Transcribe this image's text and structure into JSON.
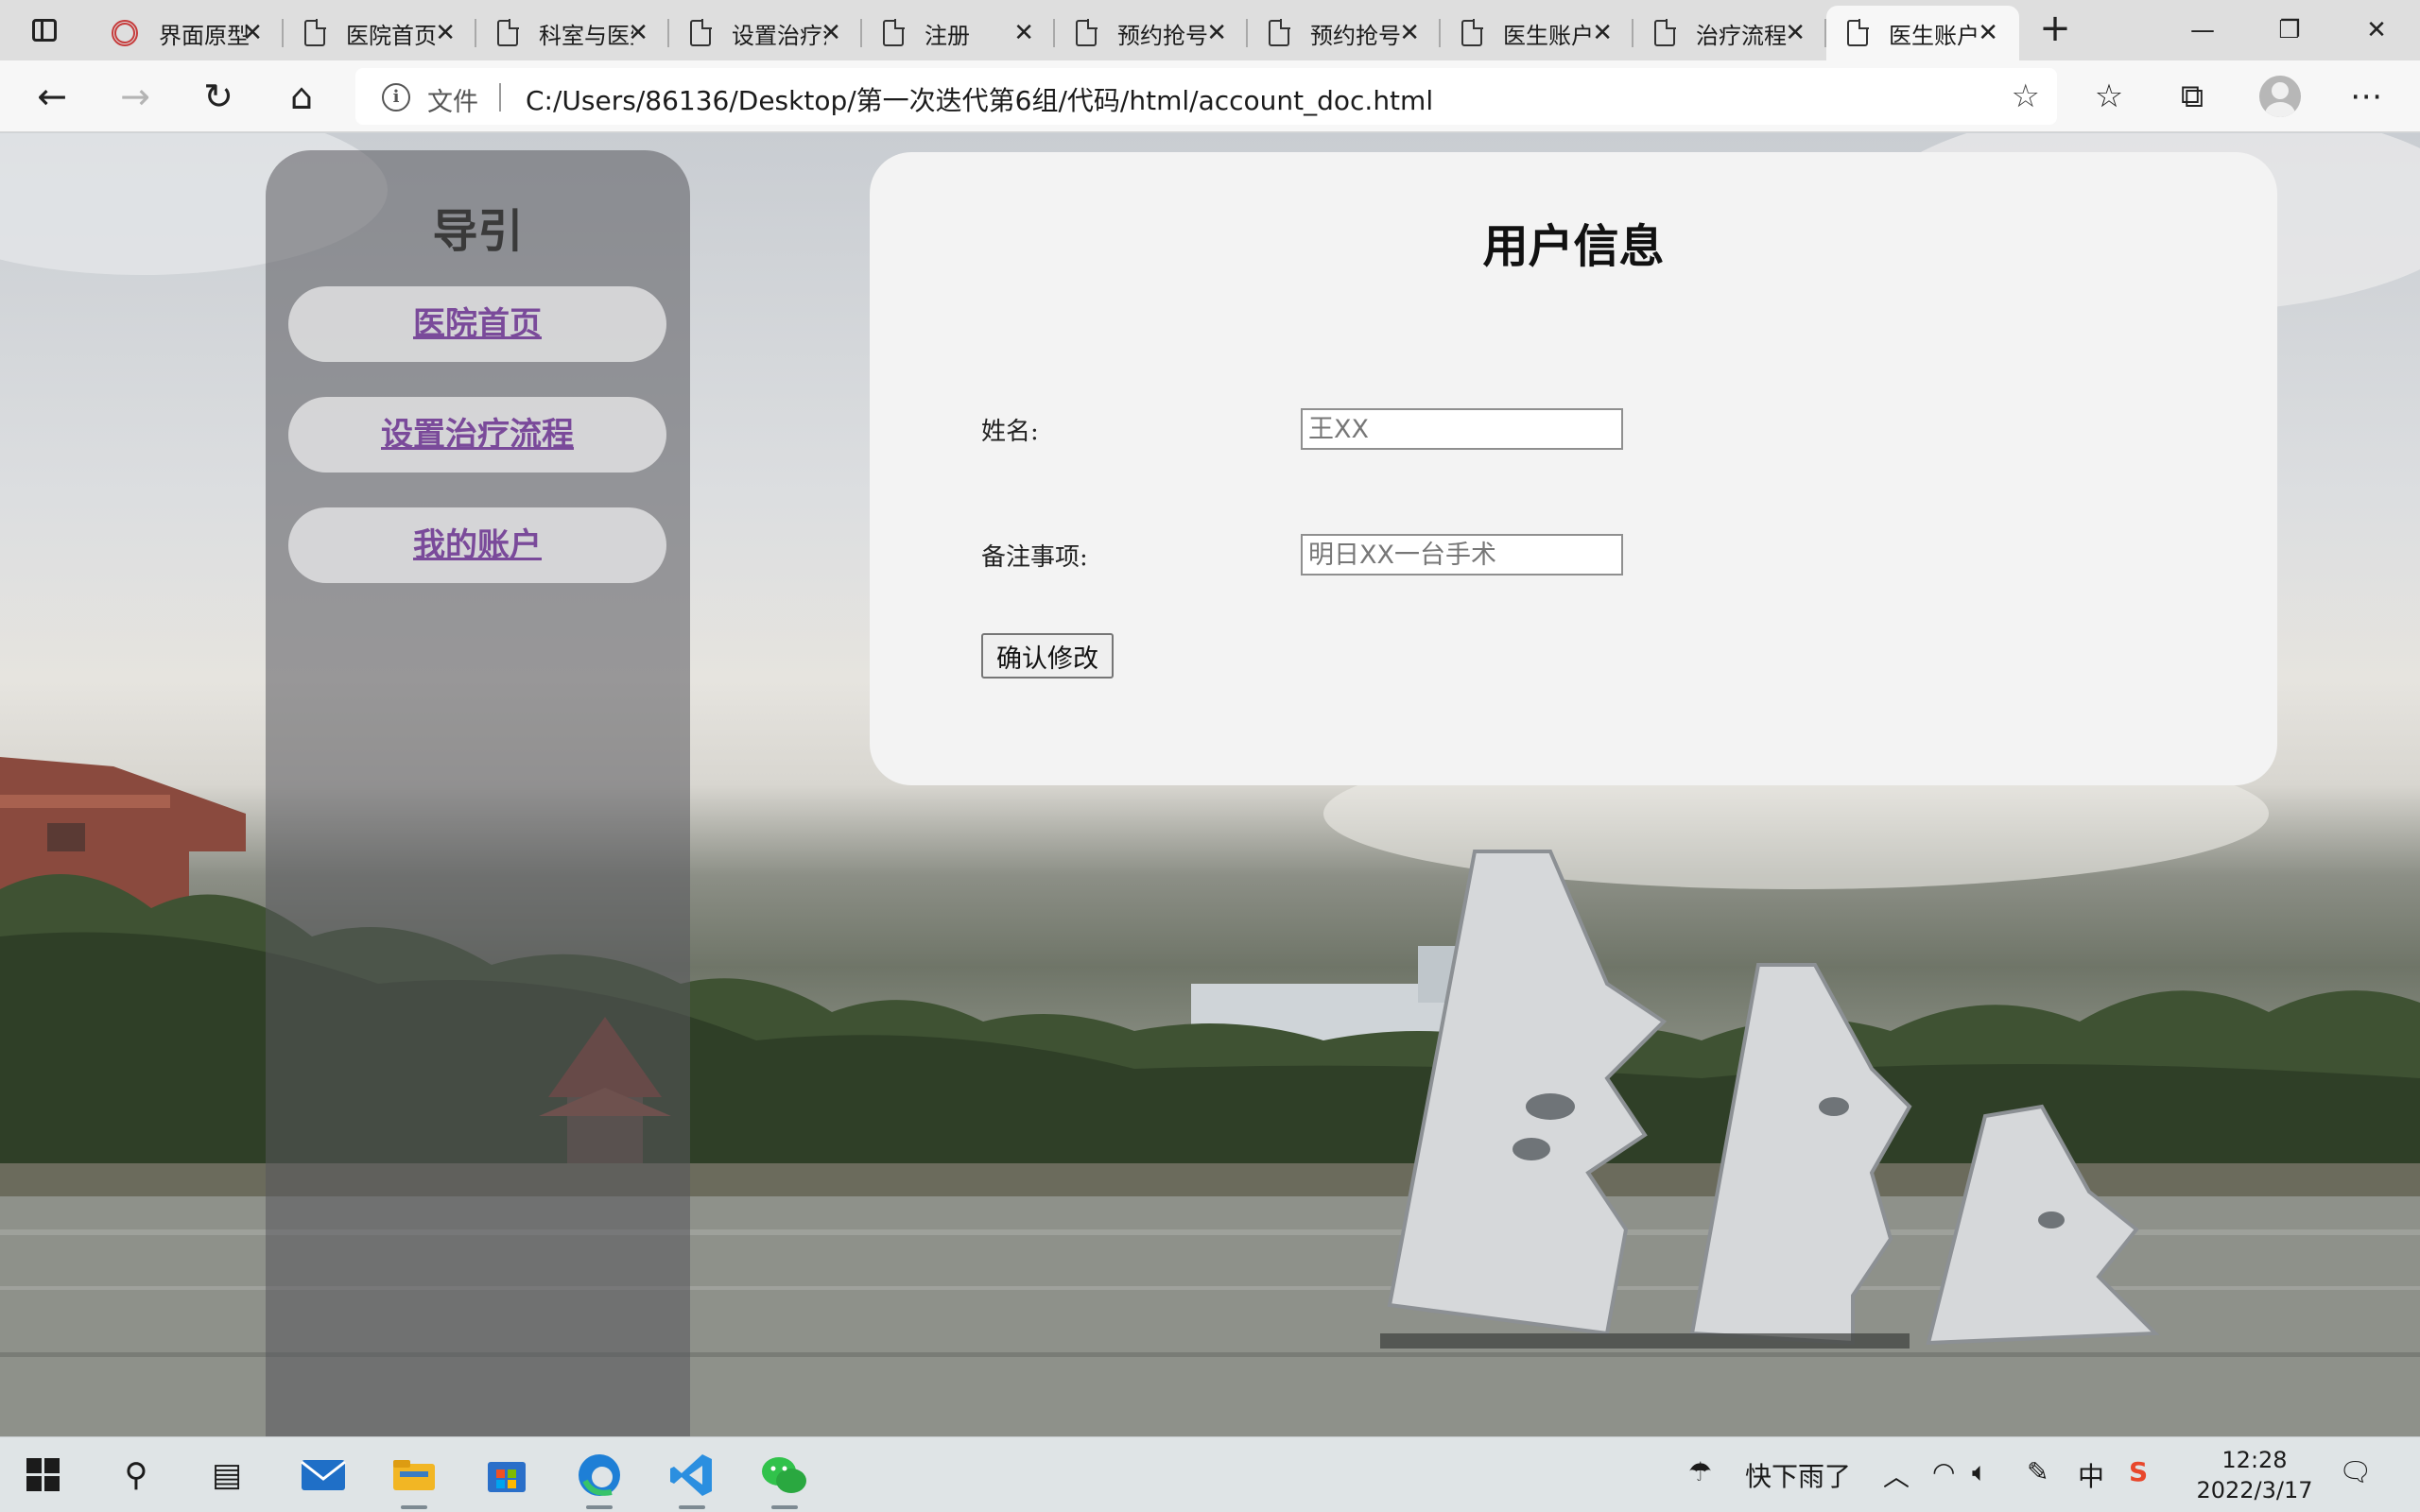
{
  "browser": {
    "tabs": [
      {
        "label": "界面原型",
        "icon": "college-logo-icon"
      },
      {
        "label": "医院首页",
        "icon": "page-icon"
      },
      {
        "label": "科室与医生",
        "icon": "page-icon"
      },
      {
        "label": "设置治疗流程",
        "icon": "page-icon"
      },
      {
        "label": "注册",
        "icon": "page-icon"
      },
      {
        "label": "预约抢号",
        "icon": "page-icon"
      },
      {
        "label": "预约抢号",
        "icon": "page-icon"
      },
      {
        "label": "医生账户",
        "icon": "page-icon"
      },
      {
        "label": "治疗流程",
        "icon": "page-icon"
      },
      {
        "label": "医生账户",
        "icon": "page-icon",
        "active": true
      }
    ],
    "scheme_label": "文件",
    "url": "C:/Users/86136/Desktop/第一次迭代第6组/代码/html/account_doc.html"
  },
  "sidebar": {
    "title": "导引",
    "links": [
      {
        "label": "医院首页"
      },
      {
        "label": "设置治疗流程"
      },
      {
        "label": "我的账户"
      }
    ]
  },
  "card": {
    "title": "用户信息",
    "fields": [
      {
        "label": "姓名:",
        "placeholder": "王XX"
      },
      {
        "label": "备注事项:",
        "placeholder": "明日XX一台手术"
      }
    ],
    "submit_label": "确认修改"
  },
  "taskbar": {
    "weather": "快下雨了",
    "ime": "中",
    "time": "12:28",
    "date": "2022/3/17"
  },
  "colors": {
    "link": "#7a4a9a",
    "edge_blue": "#1e7fd6",
    "vscode_blue": "#2b8fe0",
    "wechat_green": "#31c24b"
  }
}
